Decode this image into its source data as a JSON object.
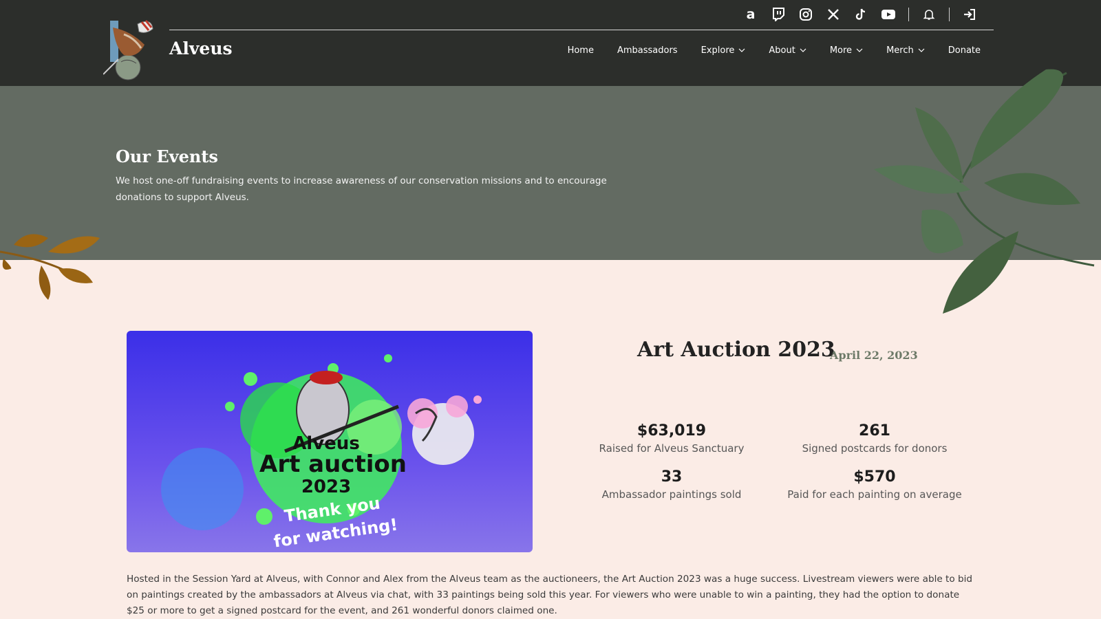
{
  "header": {
    "site_title": "Alveus",
    "social_icons": [
      "amazon-icon",
      "twitch-icon",
      "instagram-icon",
      "x-icon",
      "tiktok-icon",
      "youtube-icon"
    ],
    "nav": [
      {
        "label": "Home",
        "dropdown": false
      },
      {
        "label": "Ambassadors",
        "dropdown": false
      },
      {
        "label": "Explore",
        "dropdown": true
      },
      {
        "label": "About",
        "dropdown": true
      },
      {
        "label": "More",
        "dropdown": true
      },
      {
        "label": "Merch",
        "dropdown": true
      },
      {
        "label": "Donate",
        "dropdown": false
      }
    ]
  },
  "hero": {
    "title": "Our Events",
    "description": "We host one-off fundraising events to increase awareness of our conservation missions and to encourage donations to support Alveus."
  },
  "event": {
    "title": "Art Auction 2023",
    "date": "April 22, 2023",
    "image_text": {
      "line1": "Alveus",
      "line2": "Art auction",
      "line3": "2023",
      "line4": "Thank you",
      "line5": "for watching!"
    },
    "stats": [
      {
        "value": "$63,019",
        "label": "Raised for Alveus Sanctuary"
      },
      {
        "value": "261",
        "label": "Signed postcards for donors"
      },
      {
        "value": "33",
        "label": "Ambassador paintings sold"
      },
      {
        "value": "$570",
        "label": "Paid for each painting on average"
      }
    ],
    "description": "Hosted in the Session Yard at Alveus, with Connor and Alex from the Alveus team as the auctioneers, the Art Auction 2023 was a huge success. Livestream viewers were able to bid on paintings created by the ambassadors at Alveus via chat, with 33 paintings being sold this year. For viewers who were unable to win a painting, they had the option to donate $25 or more to get a signed postcard for the event, and 261 wonderful donors claimed one."
  },
  "colors": {
    "header_bg": "#2c2e2b",
    "hero_bg": "#636b62",
    "page_bg": "#fbece6",
    "date_color": "#6d7a68"
  }
}
